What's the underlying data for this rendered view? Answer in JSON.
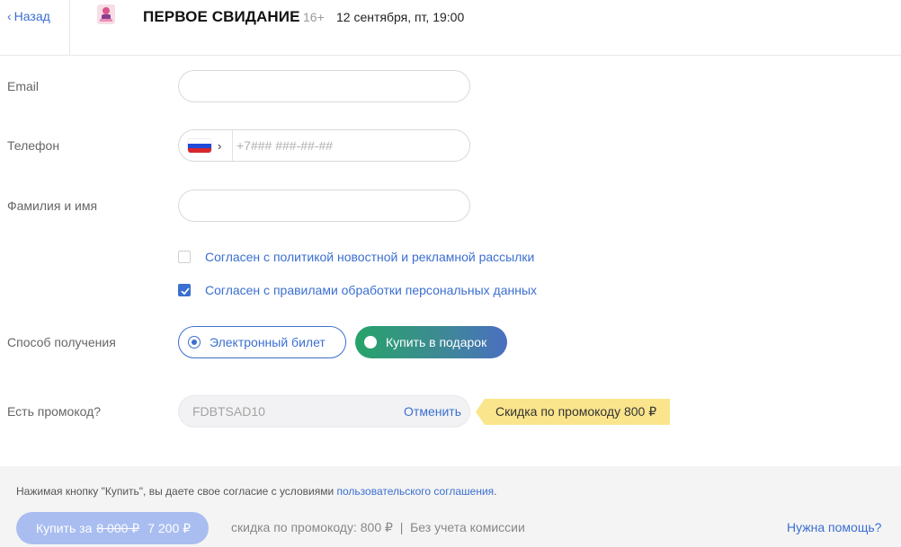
{
  "header": {
    "back_label": "Назад",
    "title": "ПЕРВОЕ СВИДАНИЕ",
    "age_rating": "16+",
    "date": "12 сентября, пт, 19:00"
  },
  "form": {
    "email_label": "Email",
    "email_value": "",
    "phone_label": "Телефон",
    "phone_placeholder": "+7### ###-##-##",
    "name_label": "Фамилия и имя",
    "name_value": "",
    "checkbox_newsletter": {
      "label": "Согласен с политикой новостной и рекламной рассылки",
      "checked": false
    },
    "checkbox_personal": {
      "label": "Согласен с правилами обработки персональных данных",
      "checked": true
    },
    "delivery_label": "Способ получения",
    "delivery_options": [
      {
        "label": "Электронный билет",
        "selected": true
      },
      {
        "label": "Купить в подарок",
        "selected": false
      }
    ],
    "promo_label": "Есть промокод?",
    "promo_code": "FDBTSAD10",
    "promo_cancel": "Отменить",
    "promo_badge": "Скидка по промокоду 800 ₽"
  },
  "footer": {
    "agreement_text": "Нажимая кнопку \"Купить\", вы даете свое согласие с условиями",
    "agreement_link": "пользовательского соглашения",
    "agreement_end": ".",
    "buy_prefix": "Купить за",
    "old_price": "8 000 ₽",
    "new_price": "7 200 ₽",
    "discount_note": "скидка по промокоду: 800 ₽  |  Без учета комиссии",
    "help_link": "Нужна помощь?"
  },
  "colors": {
    "accent": "#3b6fd0",
    "promo_badge_bg": "#fbe58c",
    "buy_button_bg": "#a9bdf0"
  }
}
